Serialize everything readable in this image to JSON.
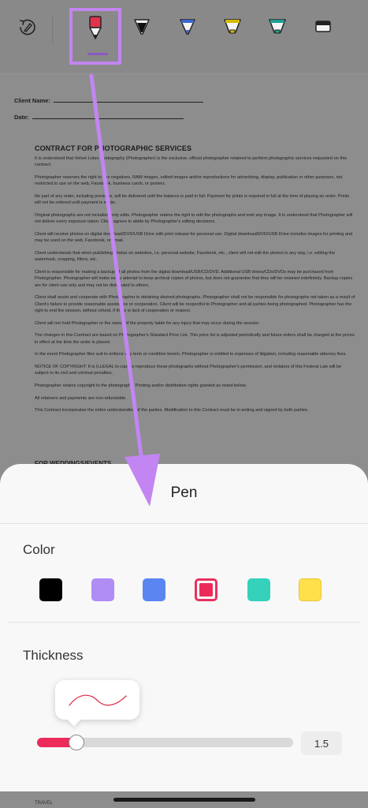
{
  "toolbar": {
    "tools": [
      {
        "name": "undo-lasso",
        "icon": "lasso-undo-icon"
      },
      {
        "name": "pen",
        "icon": "red-pen-icon",
        "selected": true
      },
      {
        "name": "marker-black",
        "icon": "black-marker-icon"
      },
      {
        "name": "marker-blue",
        "icon": "blue-marker-icon"
      },
      {
        "name": "highlighter-yellow",
        "icon": "yellow-highlighter-icon"
      },
      {
        "name": "highlighter-teal",
        "icon": "teal-highlighter-icon"
      },
      {
        "name": "eraser",
        "icon": "eraser-icon"
      }
    ]
  },
  "document": {
    "client_name_label": "Client Name:",
    "date_label": "Date:",
    "title": "CONTRACT FOR PHOTOGRAPHIC SERVICES",
    "paragraphs": [
      "It is understood that Velvet Lotus Photography (Photographer) is the exclusive, official photographer retained to perform photographic services requested on this contract.",
      "Photographer reserves the right to use negatives, RAW images, edited images and/or reproductions for advertising, display, publication or other purposes, not restricted to use on the web, Facebook, business cards, or posters.",
      "No part of any order, including previews, will be delivered until the balance is paid in full. Payment for prints is required in full at the time of placing an order. Prints will not be ordered until payment is made.",
      "Original photographs are not included, only edits. Photographer retains the right to edit the photographs and omit any image. It is understood that Photographer will not deliver every exposure taken. Client agrees to abide by Photographer's editing decisions.",
      "Client will receive photos on digital download/DVD/USB Drive with print release for personal use. Digital download/DVD/USB Drive includes images for printing and may be used on the web, Facebook, or email.",
      "Client understands that when publishing photos on websites, i.e. personal website, Facebook, etc., client will not edit the photos in any way, i.e. editing the watermark, cropping, filters, etc.",
      "Client is responsible for making a backup of all photos from the digital download/USB/CD/DVD. Additional USB drives/CDs/DVDs may be purchased from Photographer. Photographer will make every attempt to keep archival copies of photos, but does not guarantee that they will be retained indefinitely. Backup copies are for client use only and may not be distributed to others.",
      "Client shall assist and cooperate with Photographer in obtaining desired photographs. Photographer shall not be responsible for photographs not taken as a result of Client's failure to provide reasonable assistance or cooperation. Client will be respectful to Photographer and all parties being photographed. Photographer has the right to end the session, without refund, if there is lack of cooperation or respect.",
      "Client will not hold Photographer or the owner of the property liable for any injury that may occur during the session.",
      "The changes in this Contract are based on Photographer's Standard Price List. This price list is adjusted periodically and future orders shall be charged at the prices in effect at the time the order is placed.",
      "In the event Photographer files suit to enforce any term or condition herein, Photographer is entitled to expenses of litigation, including reasonable attorney fees.",
      "NOTICE OF COPYRIGHT: It is ILLEGAL to copy or reproduce these photographs without Photographer's permission, and violators of this Federal Law will be subject to its civil and criminal penalties.",
      "Photographer retains copyright to the photographs. Printing and/or distribution rights granted as noted below.",
      "All retainers and payments are non-refundable.",
      "This Contract incorporates the entire understanding of the parties. Modification to this Contract must be in writing and signed by both parties."
    ],
    "subheading": "FOR WEDDINGS/EVENTS",
    "footer_text": "TRAVEL"
  },
  "sheet": {
    "title": "Pen",
    "color_label": "Color",
    "colors": [
      "#000000",
      "#b08cf5",
      "#5b86f2",
      "#ec2b5b",
      "#35d1bb",
      "#ffe04a"
    ],
    "selected_color": "#ec2b5b",
    "thickness_label": "Thickness",
    "thickness_value": "1.5",
    "thickness_fraction": 0.155
  },
  "accent": "#c285f2"
}
